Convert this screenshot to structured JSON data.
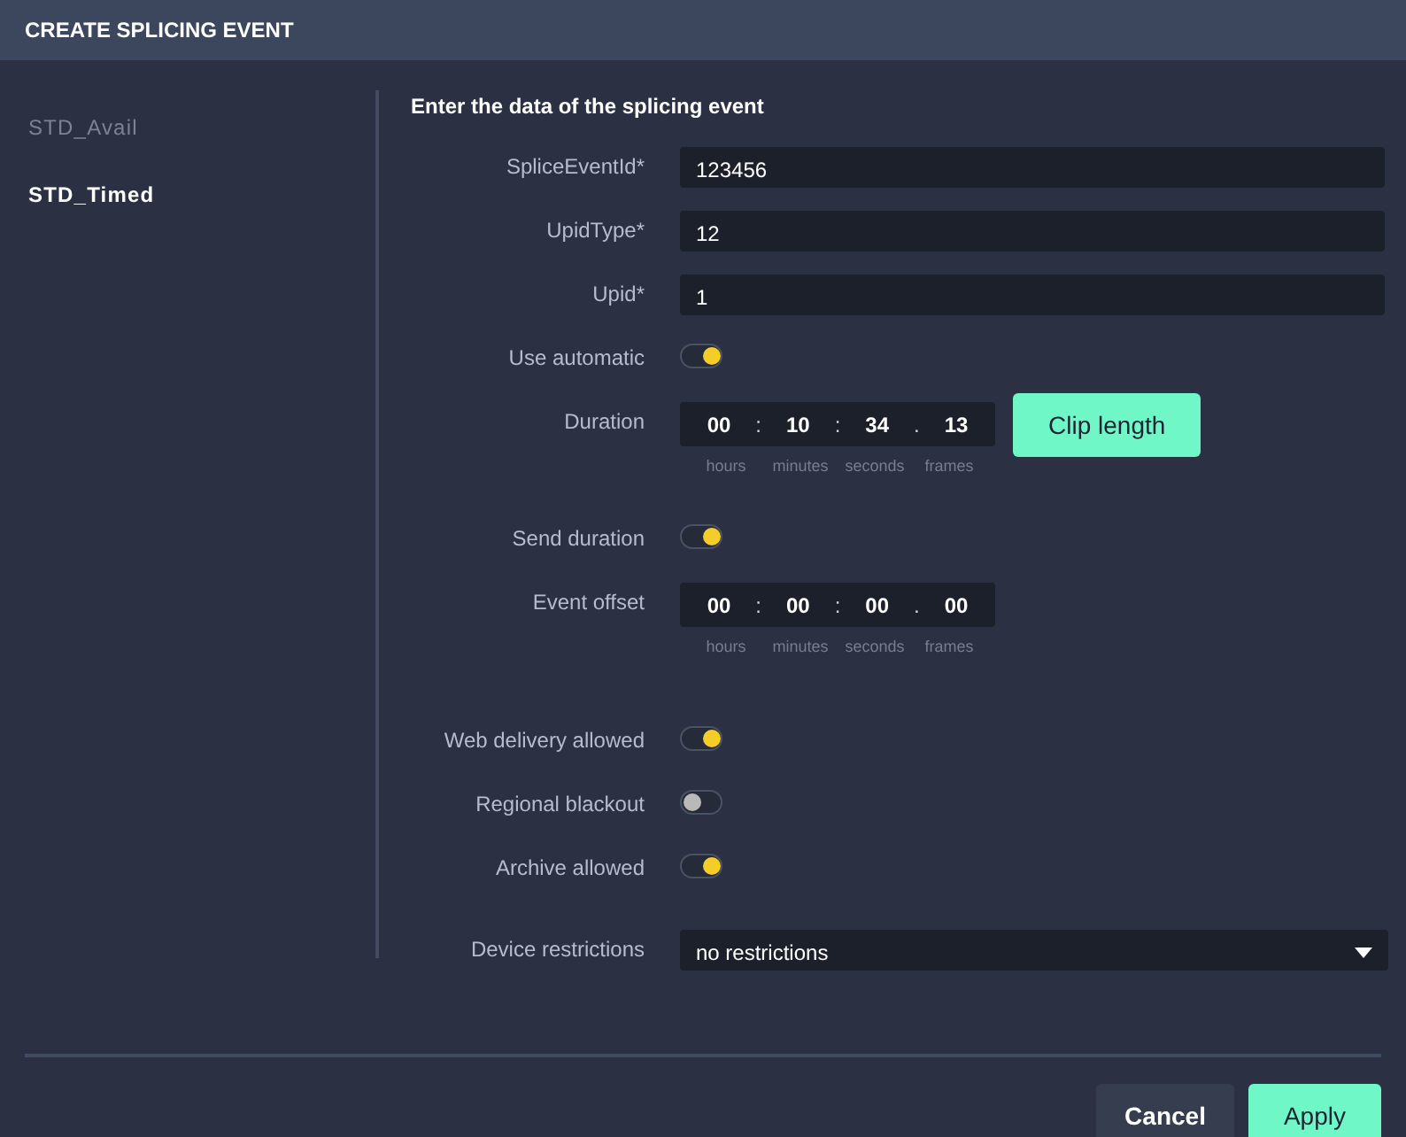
{
  "window": {
    "title": "CREATE SPLICING EVENT"
  },
  "sidebar": {
    "items": [
      {
        "label": "STD_Avail",
        "selected": false
      },
      {
        "label": "STD_Timed",
        "selected": true
      }
    ]
  },
  "form": {
    "heading": "Enter the data of the splicing event",
    "rows": [
      {
        "kind": "text",
        "label": "SpliceEventId*",
        "value": "123456"
      },
      {
        "kind": "text",
        "label": "UpidType*",
        "value": "12"
      },
      {
        "kind": "text",
        "label": "Upid*",
        "value": "1"
      },
      {
        "kind": "toggle",
        "label": "Use automatic",
        "on": true
      },
      {
        "kind": "timecode",
        "label": "Duration",
        "segments": [
          {
            "value": "00",
            "unit": "hours"
          },
          {
            "value": "10",
            "unit": "minutes"
          },
          {
            "value": "34",
            "unit": "seconds"
          },
          {
            "value": "13",
            "unit": "frames"
          }
        ],
        "separators": [
          ":",
          ":",
          "."
        ],
        "button": "Clip length"
      },
      {
        "kind": "toggle",
        "label": "Send duration",
        "on": true
      },
      {
        "kind": "timecode",
        "label": "Event offset",
        "segments": [
          {
            "value": "00",
            "unit": "hours"
          },
          {
            "value": "00",
            "unit": "minutes"
          },
          {
            "value": "00",
            "unit": "seconds"
          },
          {
            "value": "00",
            "unit": "frames"
          }
        ],
        "separators": [
          ":",
          ":",
          "."
        ]
      },
      {
        "kind": "toggle",
        "label": "Web delivery allowed",
        "on": true
      },
      {
        "kind": "toggle",
        "label": "Regional blackout",
        "on": false
      },
      {
        "kind": "toggle",
        "label": "Archive allowed",
        "on": true
      },
      {
        "kind": "select",
        "label": "Device restrictions",
        "value": "no restrictions"
      }
    ]
  },
  "buttons": [
    {
      "label": "Cancel",
      "kind": "secondary"
    },
    {
      "label": "Apply",
      "kind": "primary"
    }
  ]
}
